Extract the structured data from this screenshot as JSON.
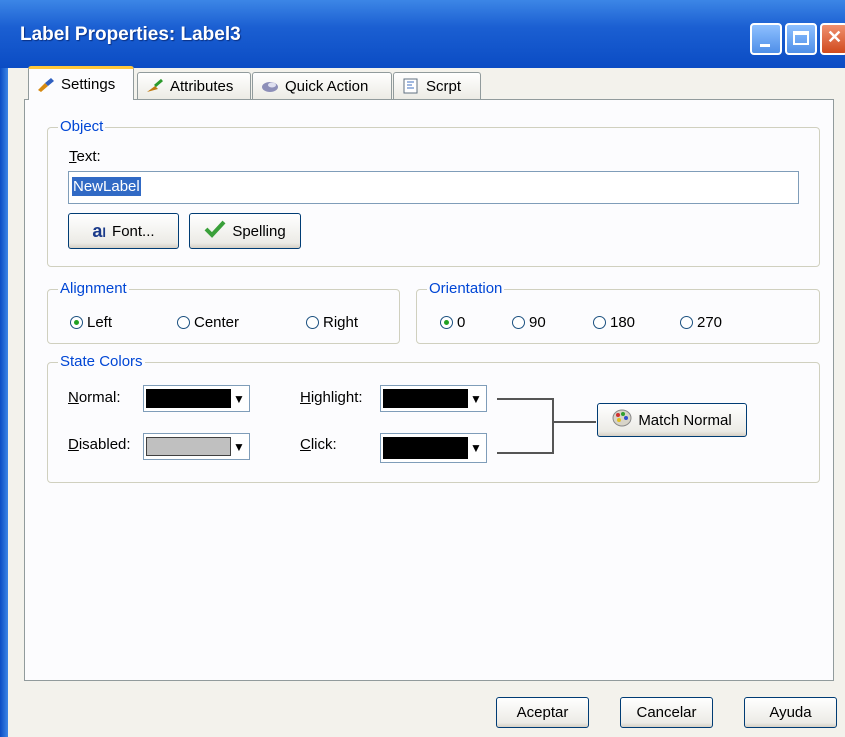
{
  "window": {
    "title": "Label Properties: Label3"
  },
  "tabs": [
    {
      "label": "Settings",
      "icon": "brush-icon"
    },
    {
      "label": "Attributes",
      "icon": "attributes-icon"
    },
    {
      "label": "Quick Action",
      "icon": "quick-action-icon"
    },
    {
      "label": "Scrpt",
      "icon": "script-icon"
    }
  ],
  "object": {
    "legend": "Object",
    "text_label": "Text:",
    "text_value": "NewLabel",
    "font_button": "Font...",
    "spelling_button": "Spelling"
  },
  "alignment": {
    "legend": "Alignment",
    "options": [
      "Left",
      "Center",
      "Right"
    ],
    "selected": "Left"
  },
  "orientation": {
    "legend": "Orientation",
    "options": [
      "0",
      "90",
      "180",
      "270"
    ],
    "selected": "0"
  },
  "state_colors": {
    "legend": "State Colors",
    "normal_label": "Normal:",
    "disabled_label": "Disabled:",
    "highlight_label": "Highlight:",
    "click_label": "Click:",
    "normal_color": "#000000",
    "disabled_color": "#c0c0c0",
    "highlight_color": "#000000",
    "click_color": "#000000",
    "match_button": "Match Normal"
  },
  "footer": {
    "ok": "Aceptar",
    "cancel": "Cancelar",
    "help": "Ayuda"
  },
  "colors": {
    "title_bar": "#0b4cc4",
    "group_legend": "#0046d5",
    "active_tab_accent": "#ffc83c"
  }
}
